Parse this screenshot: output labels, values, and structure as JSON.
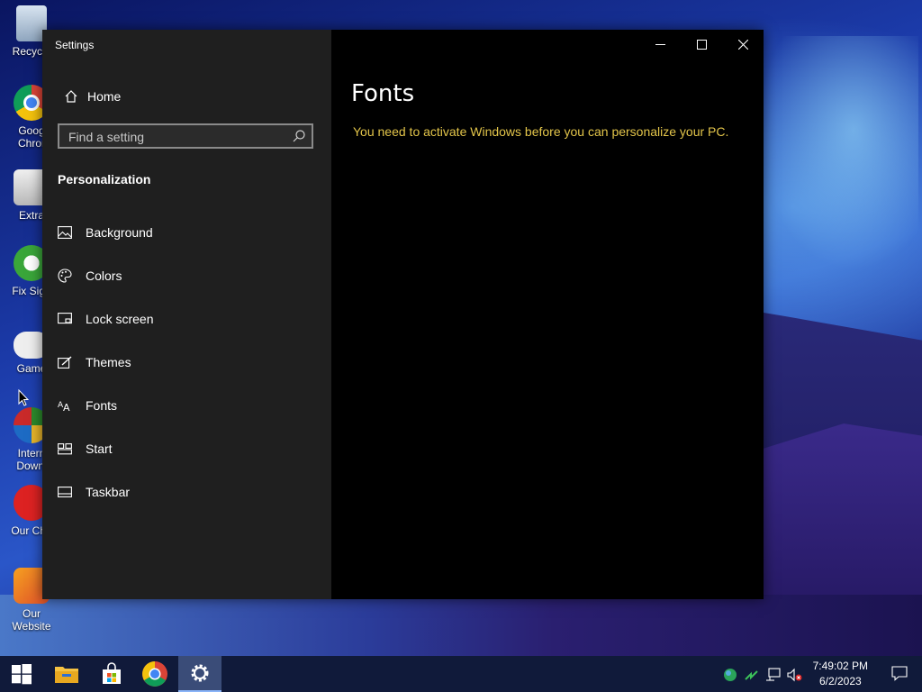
{
  "desktop": {
    "icons": [
      {
        "label": "Recycle",
        "icon": "recycle-bin-icon"
      },
      {
        "label": "Goog Chror",
        "icon": "chrome-icon"
      },
      {
        "label": "Extra",
        "icon": "folder-icon"
      },
      {
        "label": "Fix Sign",
        "icon": "xbox-icon"
      },
      {
        "label": "Game",
        "icon": "gamepad-icon"
      },
      {
        "label": "Intern Downl",
        "icon": "idm-icon"
      },
      {
        "label": "Our Cha",
        "icon": "youtube-icon"
      },
      {
        "label": "Our Website",
        "icon": "website-icon"
      }
    ]
  },
  "window": {
    "title": "Settings",
    "controls": {
      "minimize": "minimize-icon",
      "maximize": "maximize-icon",
      "close": "close-icon"
    }
  },
  "sidebar": {
    "home_label": "Home",
    "search_placeholder": "Find a setting",
    "section_title": "Personalization",
    "items": [
      {
        "label": "Background",
        "icon": "background-icon"
      },
      {
        "label": "Colors",
        "icon": "palette-icon"
      },
      {
        "label": "Lock screen",
        "icon": "lock-screen-icon"
      },
      {
        "label": "Themes",
        "icon": "themes-icon"
      },
      {
        "label": "Fonts",
        "icon": "fonts-icon"
      },
      {
        "label": "Start",
        "icon": "start-icon"
      },
      {
        "label": "Taskbar",
        "icon": "taskbar-icon"
      }
    ]
  },
  "main": {
    "title": "Fonts",
    "message": "You need to activate Windows before you can personalize your PC.",
    "message_color": "#e3c54a"
  },
  "taskbar": {
    "apps": [
      "windows-start-icon",
      "file-explorer-icon",
      "store-icon",
      "chrome-icon",
      "settings-gear-icon"
    ],
    "time": "7:49:02 PM",
    "date": "6/2/2023"
  }
}
